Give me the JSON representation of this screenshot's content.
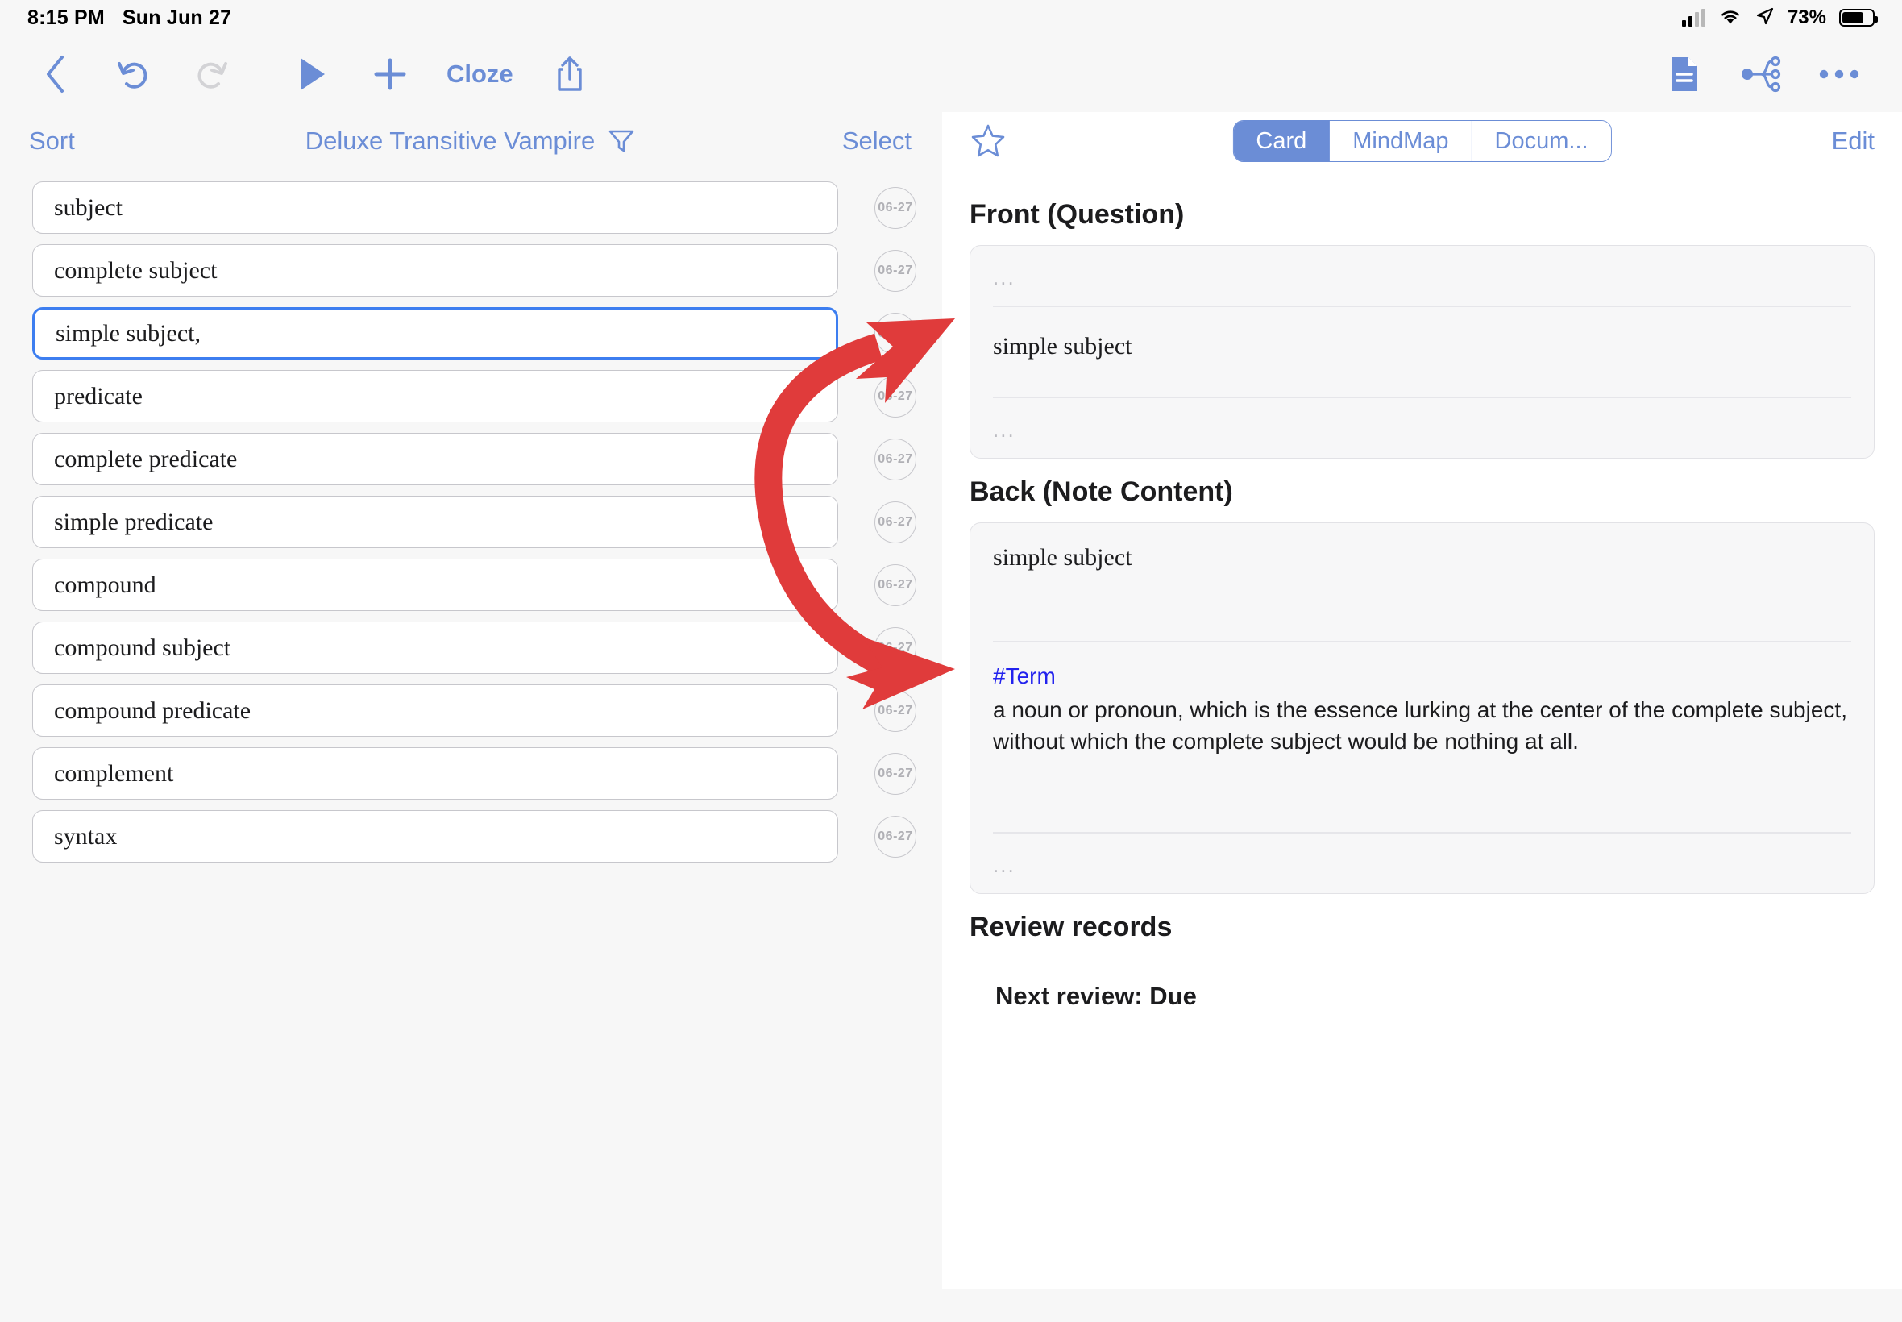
{
  "statusbar": {
    "time": "8:15 PM",
    "date": "Sun Jun 27",
    "battery_percent": "73%",
    "icons": [
      "cellular-signal-icon",
      "wifi-icon",
      "location-arrow-icon",
      "battery-icon"
    ]
  },
  "toolbar": {
    "back_label": "back-chevron",
    "undo_label": "undo",
    "redo_label": "redo",
    "play_label": "play",
    "add_label": "add",
    "cloze_label": "Cloze",
    "share_label": "share",
    "document_label": "document",
    "mindmap_label": "mindmap",
    "more_label": "more"
  },
  "left_panel": {
    "sort_label": "Sort",
    "title": "Deluxe Transitive Vampire",
    "filter_icon": "filter-icon",
    "select_label": "Select",
    "items": [
      {
        "text": "subject",
        "date": "06-27",
        "selected": false
      },
      {
        "text": "complete subject",
        "date": "06-27",
        "selected": false
      },
      {
        "text": "simple subject,",
        "date": "06-27",
        "selected": true
      },
      {
        "text": "predicate",
        "date": "06-27",
        "selected": false
      },
      {
        "text": "complete predicate",
        "date": "06-27",
        "selected": false
      },
      {
        "text": "simple predicate",
        "date": "06-27",
        "selected": false
      },
      {
        "text": "compound",
        "date": "06-27",
        "selected": false
      },
      {
        "text": "compound subject",
        "date": "06-27",
        "selected": false
      },
      {
        "text": "compound predicate",
        "date": "06-27",
        "selected": false
      },
      {
        "text": "complement",
        "date": "06-27",
        "selected": false
      },
      {
        "text": "syntax",
        "date": "06-27",
        "selected": false
      }
    ]
  },
  "right_panel": {
    "star_icon": "star-outline-icon",
    "edit_label": "Edit",
    "segments": [
      {
        "label": "Card",
        "active": true
      },
      {
        "label": "MindMap",
        "active": false
      },
      {
        "label": "Docum...",
        "active": false
      }
    ],
    "front": {
      "heading": "Front (Question)",
      "placeholder_top": "...",
      "value": "simple subject",
      "placeholder_bottom": "..."
    },
    "back": {
      "heading": "Back (Note Content)",
      "value": "simple subject",
      "tag": "#Term",
      "body": "a noun or pronoun, which is the essence lurking at the center of the complete subject, without which the complete subject would be nothing at all.",
      "placeholder_bottom": "..."
    },
    "review": {
      "heading": "Review records",
      "next_review": "Next review: Due"
    }
  },
  "annotation": {
    "name": "red-double-arrow",
    "color": "#e03b3b"
  },
  "colors": {
    "accent_blue": "#6b8dd6",
    "selection_blue": "#3d7ef0",
    "tag_blue": "#2222ee",
    "annotation_red": "#e03b3b",
    "panel_bg": "#f7f7f8",
    "page_bg": "#f7f7f7"
  }
}
